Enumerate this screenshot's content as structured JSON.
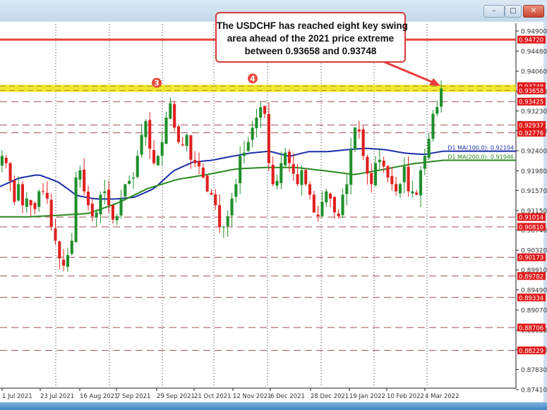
{
  "window": {
    "minimize_icon": "minimize-icon",
    "restore_icon": "restore-icon",
    "close_icon": "close-icon"
  },
  "annotation": {
    "lines": [
      "The USDCHF has reached eight key swing",
      "area ahead of the 2021 price extreme",
      "between 0.93658 and 0.93748"
    ]
  },
  "chart_data": {
    "type": "candlestick",
    "symbol": "USDCHF",
    "timeframe": "D1",
    "ylim": [
      0.8741,
      0.949
    ],
    "y_ticks": [
      "0.94900",
      "0.94480",
      "0.94060",
      "0.93640",
      "0.93230",
      "0.92820",
      "0.92400",
      "0.91980",
      "0.91570",
      "0.91150",
      "0.90740",
      "0.90320",
      "0.89910",
      "0.89490",
      "0.89070",
      "0.88650",
      "0.88240",
      "0.87830",
      "0.87410"
    ],
    "x_ticks": [
      "1 Jul 2021",
      "23 Jul 2021",
      "16 Aug 2021",
      "7 Sep 2021",
      "29 Sep 2021",
      "21 Oct 2021",
      "12 Nov 2021",
      "6 Dec 2021",
      "28 Dec 2021",
      "19 Jan 2022",
      "10 Feb 2022",
      "4 Mar 2022"
    ],
    "close_path": [
      0.9229,
      0.9214,
      0.9177,
      0.9133,
      0.917,
      0.9126,
      0.914,
      0.9126,
      0.9118,
      0.9155,
      0.9155,
      0.914,
      0.9081,
      0.9052,
      0.9015,
      0.9,
      0.9022,
      0.9052,
      0.9184,
      0.9199,
      0.9155,
      0.9126,
      0.9103,
      0.9111,
      0.9148,
      0.9155,
      0.9126,
      0.9096,
      0.9103,
      0.914,
      0.917,
      0.9177,
      0.9184,
      0.9229,
      0.9273,
      0.9302,
      0.9244,
      0.9214,
      0.9229,
      0.9258,
      0.9309,
      0.9339,
      0.9288,
      0.9258,
      0.9251,
      0.9273,
      0.9221,
      0.9214,
      0.9207,
      0.9184,
      0.9155,
      0.9148,
      0.9126,
      0.9081,
      0.9081,
      0.9103,
      0.914,
      0.917,
      0.9229,
      0.9236,
      0.9258,
      0.9288,
      0.9309,
      0.9331,
      0.9317,
      0.9214,
      0.917,
      0.9177,
      0.9214,
      0.9236,
      0.9214,
      0.9192,
      0.917,
      0.9199,
      0.917,
      0.9148,
      0.9111,
      0.9103,
      0.9133,
      0.9155,
      0.914,
      0.9111,
      0.9103,
      0.9148,
      0.917,
      0.9243,
      0.9288,
      0.928,
      0.9229,
      0.9192,
      0.917,
      0.9214,
      0.9221,
      0.9207,
      0.9184,
      0.917,
      0.9155,
      0.917,
      0.9207,
      0.9155,
      0.9155,
      0.9148,
      0.9199,
      0.9229,
      0.9265,
      0.9317,
      0.9331,
      0.937
    ],
    "moving_averages": [
      {
        "label": "D1 MA(100,0): 0.92104",
        "color": "#1a2fa8",
        "path": [
          0.9165,
          0.9183,
          0.919,
          0.9175,
          0.9146,
          0.9139,
          0.9139,
          0.9143,
          0.9161,
          0.9198,
          0.9216,
          0.922,
          0.9228,
          0.9235,
          0.9239,
          0.9228,
          0.9238,
          0.9238,
          0.9242,
          0.9245,
          0.9242,
          0.9235,
          0.9232,
          0.9239
        ]
      },
      {
        "label": "D1 MA(200,0): 0.91946",
        "color": "#2a8a1f",
        "path": [
          0.9102,
          0.9102,
          0.9105,
          0.9109,
          0.9131,
          0.9161,
          0.918,
          0.919,
          0.9202,
          0.9205,
          0.9205,
          0.9198,
          0.919,
          0.9201,
          0.9213,
          0.922
        ]
      }
    ],
    "levels": {
      "extreme_line": "0.94720",
      "swing_area": [
        "0.93748",
        "0.93658"
      ],
      "dashed": [
        "0.93425",
        "0.92937",
        "0.92776",
        "0.91014",
        "0.90810",
        "0.90173",
        "0.89782",
        "0.89334",
        "0.88706",
        "0.88229"
      ]
    },
    "markers": [
      {
        "label": "3",
        "price": 0.937
      },
      {
        "label": "4",
        "price": 0.9379
      }
    ],
    "colors": {
      "bull": "#1f8f2a",
      "bear": "#e02020",
      "level": "#a05050",
      "extreme": "#e8453c",
      "band": "#f0e830",
      "tag": "#e01818"
    }
  }
}
